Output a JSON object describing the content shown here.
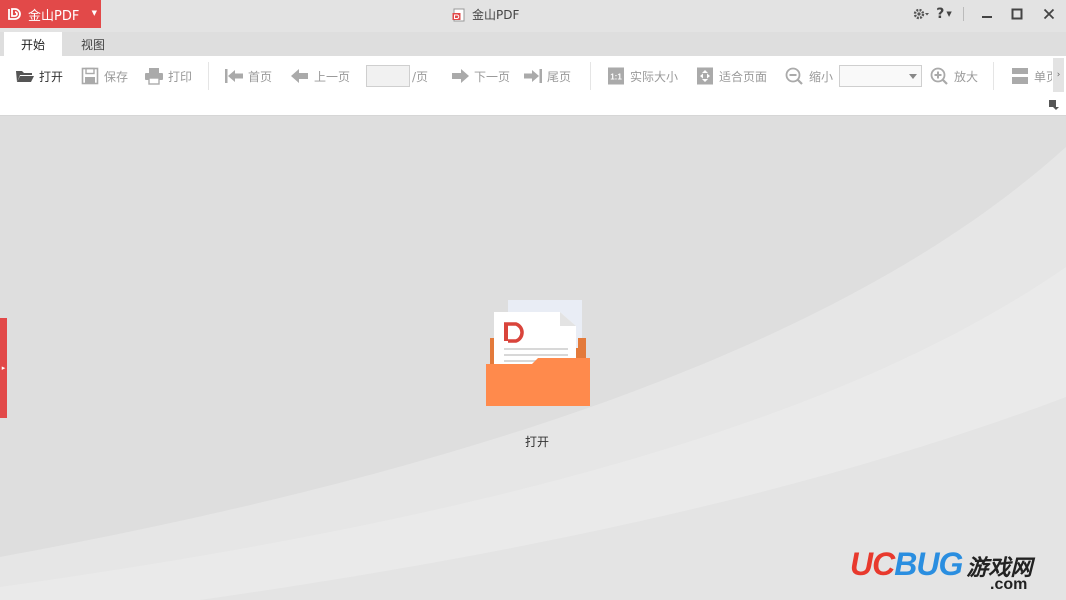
{
  "app": {
    "name": "金山PDF",
    "window_title": "金山PDF",
    "brand_color": "#e24949"
  },
  "title_controls": {
    "settings_icon": "gear-icon",
    "help_label": "?",
    "minimize_icon": "minimize-icon",
    "maximize_icon": "maximize-icon",
    "close_icon": "close-icon"
  },
  "tabs": [
    {
      "label": "开始",
      "active": true
    },
    {
      "label": "视图",
      "active": false
    }
  ],
  "toolbar": {
    "open_label": "打开",
    "save_label": "保存",
    "print_label": "打印",
    "first_page_label": "首页",
    "prev_page_label": "上一页",
    "page_input_value": "",
    "page_suffix": "/页",
    "next_page_label": "下一页",
    "last_page_label": "尾页",
    "actual_size_label": "实际大小",
    "fit_page_label": "适合页面",
    "zoom_out_label": "缩小",
    "zoom_value": "",
    "zoom_in_label": "放大",
    "single_page_label": "单页"
  },
  "main": {
    "open_label": "打开",
    "folder_color": "#ff8a4c"
  },
  "watermark": {
    "uc": "UC",
    "bug": "BUG",
    "cn": "游戏网",
    "com": ".com"
  }
}
